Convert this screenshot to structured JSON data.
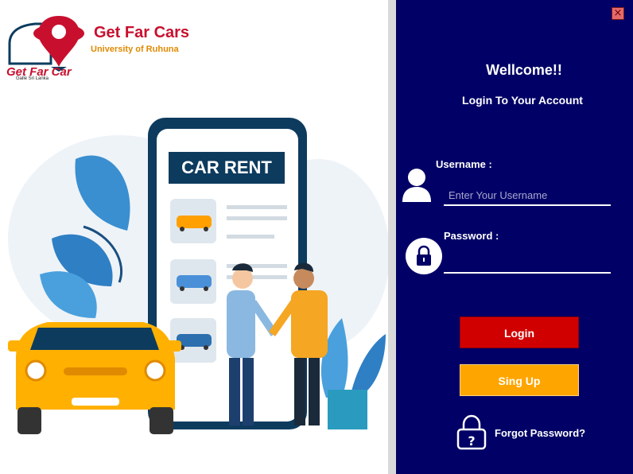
{
  "brand": {
    "title": "Get Far Cars",
    "subtitle": "University of Ruhuna",
    "logo_text": "Get Far Car",
    "logo_small": "Galle Sri Lanka"
  },
  "illustration": {
    "sign_text": "CAR RENT"
  },
  "login": {
    "welcome": "Wellcome!!",
    "subtitle": "Login To Your Account",
    "username_label": "Username :",
    "username_placeholder": "Enter Your Username",
    "password_label": "Password :",
    "login_button": "Login",
    "signup_button": "Sing Up",
    "forgot_link": "Forgot Password?",
    "close_glyph": "×"
  },
  "colors": {
    "panel": "#000066",
    "login_button": "#d00000",
    "signup_button": "#ffa500",
    "brand_red": "#c8102e",
    "car_yellow": "#ffb000"
  },
  "icons": [
    "close-icon",
    "user-icon",
    "lock-icon",
    "question-lock-icon",
    "location-pin-icon"
  ]
}
